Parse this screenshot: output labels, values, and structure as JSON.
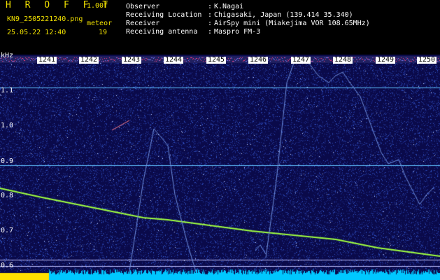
{
  "header": {
    "brand": "H R O F F T",
    "version": "1.00f",
    "filename": "KN9_2505221240.png",
    "meteor_label": "meteor",
    "datetime": "25.05.22 12:40",
    "meteor_count": "19"
  },
  "station_info": [
    {
      "label": "Observer",
      "value": "K.Nagai"
    },
    {
      "label": "Receiving Location",
      "value": "Chigasaki, Japan (139.414 35.340)"
    },
    {
      "label": "Receiver",
      "value": "AirSpy mini (Miakejima VOR 108.65MHz)"
    },
    {
      "label": "Receiving antenna",
      "value": "Maspro FM-3"
    }
  ],
  "spectrogram": {
    "freq_unit": "kHz",
    "freq_ticks": [
      "1.1",
      "1.0",
      "0.9",
      "0.8",
      "0.7",
      "0.6"
    ],
    "time_ticks": [
      "1241",
      "1242",
      "1243",
      "1244",
      "1245",
      "1246",
      "1247",
      "1248",
      "1249",
      "1250"
    ],
    "colors": {
      "background": "#0a0a4a",
      "noise": "#3050c0",
      "trace": "#a0ff40",
      "tone": "#60c0ff",
      "band": "#00c8ff",
      "marker": "#ffe000"
    }
  }
}
